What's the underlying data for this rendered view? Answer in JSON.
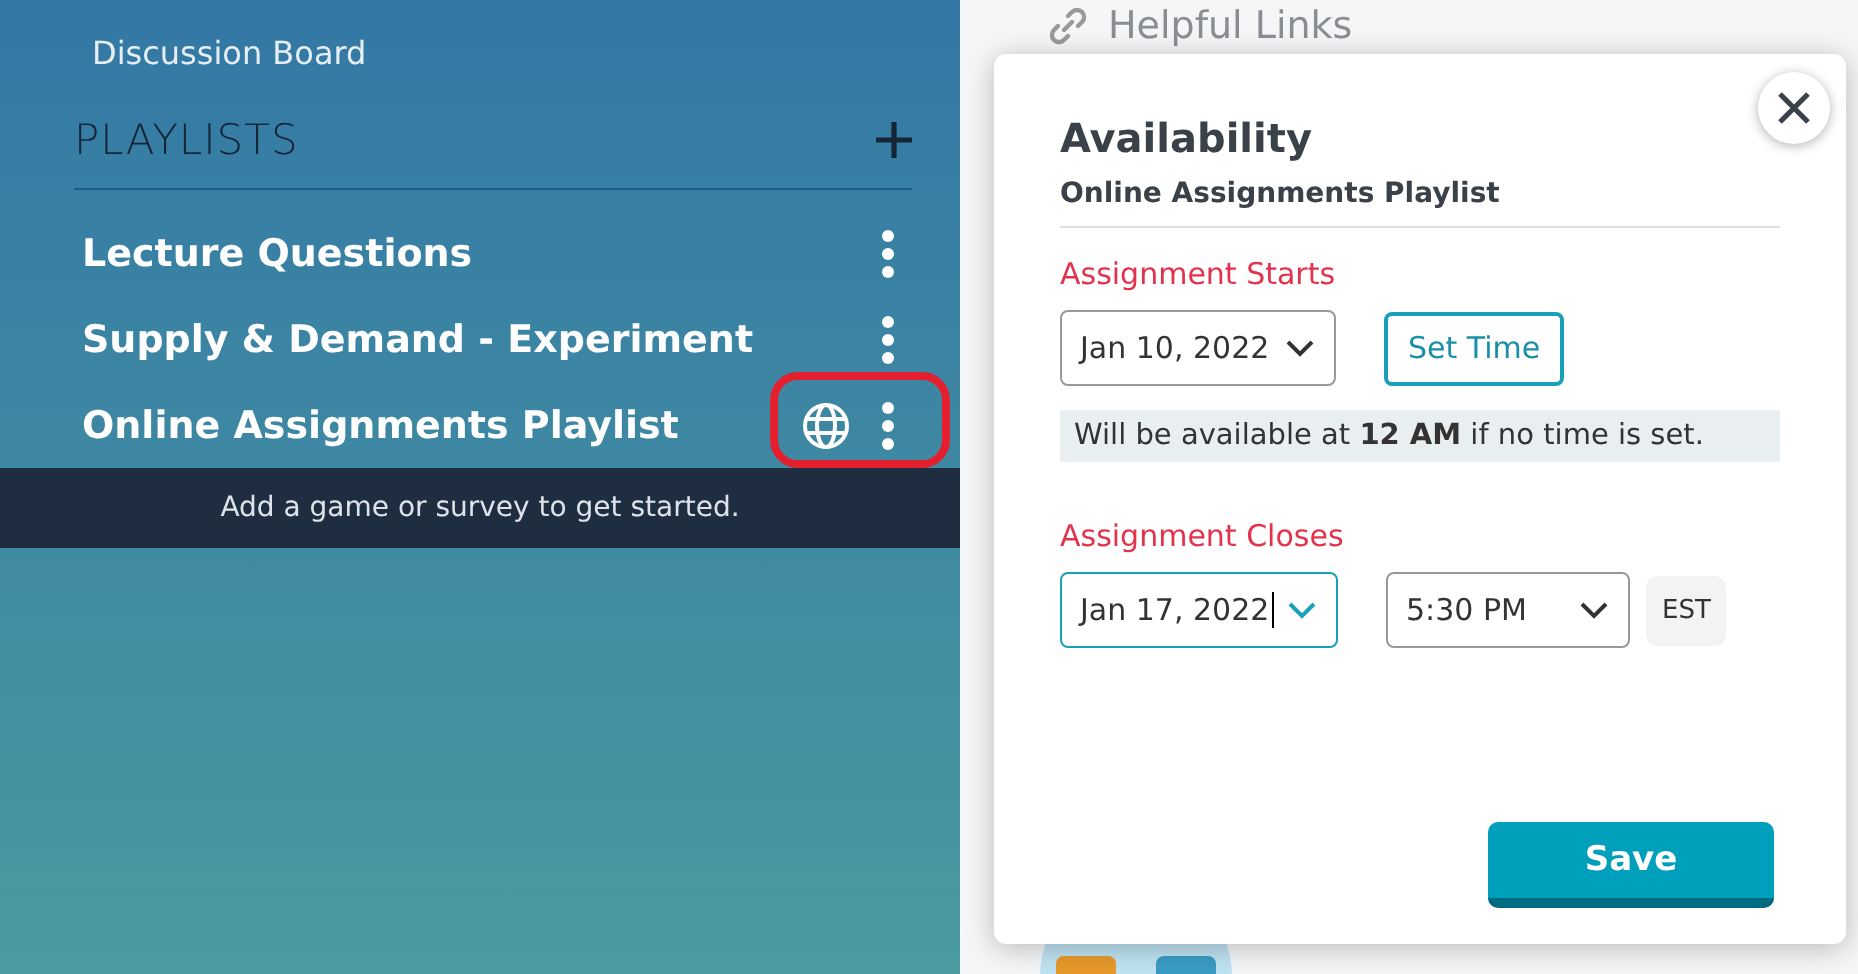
{
  "sidebar": {
    "links": [
      {
        "label": "Discussion Board"
      }
    ],
    "playlists_heading": "PLAYLISTS",
    "playlists": [
      {
        "name": "Lecture Questions",
        "published": false,
        "highlighted": false
      },
      {
        "name": "Supply & Demand - Experiment",
        "published": false,
        "highlighted": false
      },
      {
        "name": "Online Assignments Playlist",
        "published": true,
        "highlighted": true
      }
    ],
    "empty_message": "Add a game or survey to get started."
  },
  "main": {
    "helpful_links": "Helpful Links"
  },
  "dialog": {
    "title": "Availability",
    "subtitle": "Online Assignments Playlist",
    "starts_label": "Assignment Starts",
    "start_date": {
      "value": "Jan 10, 2022",
      "focused": false
    },
    "set_time_button": "Set Time",
    "info": "Will be available at **12 AM** if no time is set.",
    "closes_label": "Assignment Closes",
    "close_date": {
      "value": "Jan 17, 2022",
      "focused": true
    },
    "close_time": {
      "value": "5:30 PM",
      "focused": false
    },
    "timezone": "EST",
    "save_button": "Save"
  }
}
